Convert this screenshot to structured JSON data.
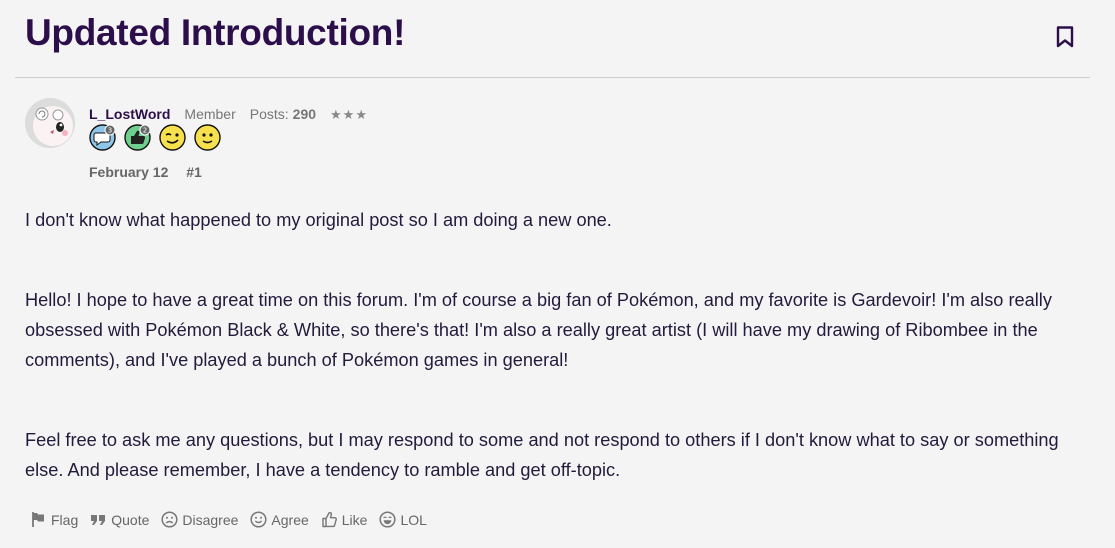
{
  "thread": {
    "title": "Updated Introduction!"
  },
  "author": {
    "username": "L_LostWord",
    "user_title": "Member",
    "posts_label": "Posts:",
    "posts_count": "290",
    "rank_stars": "★★★",
    "badges": [
      {
        "icon": "speech-bubble-badge",
        "count": "3",
        "color": "#8ec5ea"
      },
      {
        "icon": "thumbs-up-badge",
        "count": "2",
        "color": "#6fcf8f"
      },
      {
        "icon": "wink-emoji-badge",
        "color": "#f7e04d"
      },
      {
        "icon": "smile-emoji-badge",
        "color": "#f7e04d"
      }
    ]
  },
  "post": {
    "date": "February 12",
    "number": "#1",
    "paragraphs": [
      "I don't know what happened to my original post so I am doing a new one.",
      "Hello! I hope to have a great time on this forum. I'm of course a big fan of Pokémon, and my favorite is Gardevoir! I'm also really obsessed with Pokémon Black & White, so there's that! I'm also a really great artist (I will have my drawing of Ribombee in the comments), and I've played a bunch of Pokémon games in general!",
      "Feel free to ask me any questions, but I may respond to some and not respond to others if I don't know what to say or something else. And please remember, I have a tendency to ramble and get off-topic."
    ]
  },
  "actions": {
    "flag": "Flag",
    "quote": "Quote",
    "disagree": "Disagree",
    "agree": "Agree",
    "like": "Like",
    "lol": "LOL"
  },
  "colors": {
    "title": "#2c0f4a",
    "text": "#241a3c",
    "muted": "#777777",
    "background": "#f4f4f4"
  }
}
